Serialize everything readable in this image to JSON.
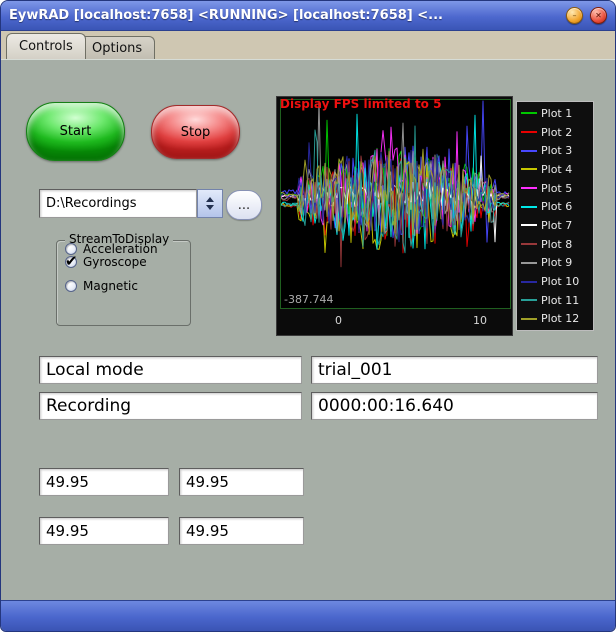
{
  "window": {
    "title": "EywRAD [localhost:7658] <RUNNING> [localhost:7658] <...",
    "minimize_glyph": "–",
    "close_glyph": "✕"
  },
  "tabs": [
    {
      "label": "Controls",
      "active": true
    },
    {
      "label": "Options",
      "active": false
    }
  ],
  "controls": {
    "start_label": "Start",
    "stop_label": "Stop",
    "path_value": "D:\\Recordings",
    "browse_label": "...",
    "check_glyph": "✔",
    "group_label": "StreamToDisplay",
    "radios": [
      {
        "label": "Acceleration",
        "checked": false
      },
      {
        "label": "Gyroscope",
        "checked": true
      },
      {
        "label": "Magnetic",
        "checked": false
      }
    ]
  },
  "plot": {
    "overlay_text": "Display FPS limited to 5",
    "y_min_label": "-387.744",
    "x_ticks": [
      "0",
      "10"
    ],
    "type": "line",
    "x_range": [
      0,
      10
    ],
    "legend": [
      {
        "label": "Plot 1",
        "color": "#00c800"
      },
      {
        "label": "Plot 2",
        "color": "#e80000"
      },
      {
        "label": "Plot 3",
        "color": "#4848ff"
      },
      {
        "label": "Plot 4",
        "color": "#c8c800"
      },
      {
        "label": "Plot 5",
        "color": "#ff30ff"
      },
      {
        "label": "Plot 6",
        "color": "#00e8e8"
      },
      {
        "label": "Plot 7",
        "color": "#ffffff"
      },
      {
        "label": "Plot 8",
        "color": "#98383a"
      },
      {
        "label": "Plot 9",
        "color": "#989898"
      },
      {
        "label": "Plot 10",
        "color": "#2828a0"
      },
      {
        "label": "Plot 11",
        "color": "#28a098"
      },
      {
        "label": "Plot 12",
        "color": "#a0a028"
      }
    ]
  },
  "fields": {
    "mode_label": "Local mode",
    "mode_value": "trial_001",
    "status_label": "Recording",
    "time_value": "0000:00:16.640",
    "rates": [
      "49.95",
      "49.95",
      "49.95",
      "49.95"
    ]
  }
}
